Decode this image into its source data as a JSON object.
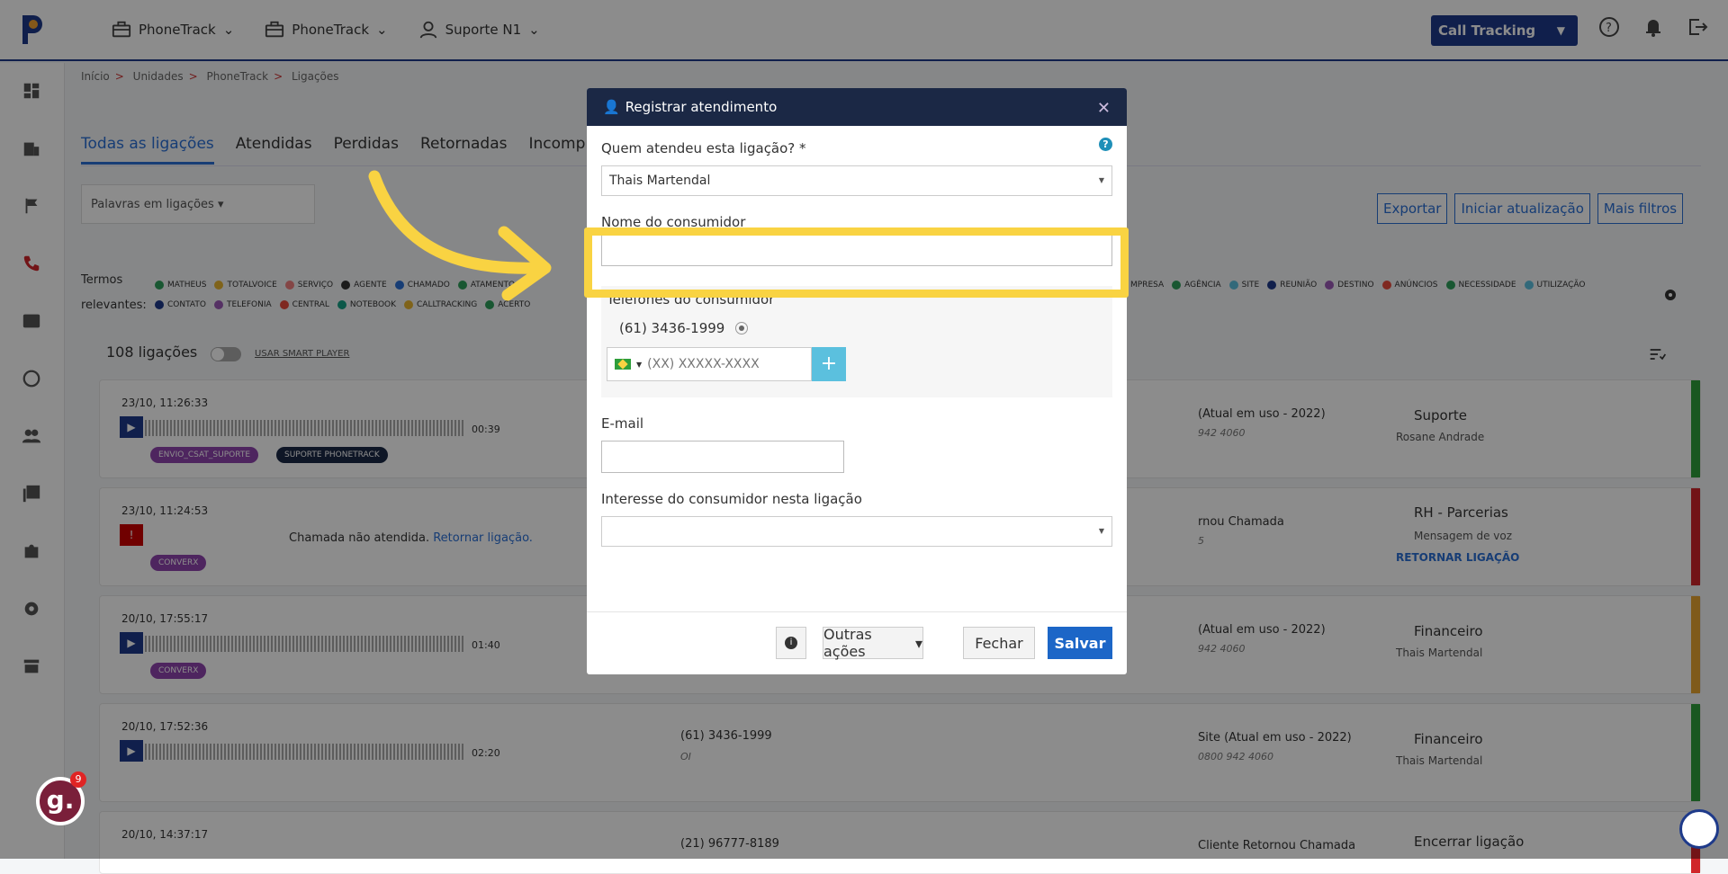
{
  "topbar": {
    "nav": [
      {
        "label": "PhoneTrack",
        "icon": "briefcase-icon"
      },
      {
        "label": "PhoneTrack",
        "icon": "briefcase-icon"
      },
      {
        "label": "Suporte N1",
        "icon": "user-icon"
      }
    ],
    "product_select": "Call Tracking"
  },
  "breadcrumb": [
    "Início",
    "Unidades",
    "PhoneTrack",
    "Ligações"
  ],
  "tabs": [
    "Todas as ligações",
    "Atendidas",
    "Perdidas",
    "Retornadas",
    "Incomple"
  ],
  "filters": {
    "search_placeholder": "Palavras em ligações",
    "buttons": [
      "Exportar",
      "Iniciar atualização",
      "Mais filtros"
    ]
  },
  "terms": {
    "label1": "Termos",
    "label2": "relevantes:",
    "row1": [
      {
        "t": "MATHEUS",
        "c": "#2e9e5b"
      },
      {
        "t": "TOTALVOICE",
        "c": "#e8b530"
      },
      {
        "t": "SERVIÇO",
        "c": "#f08080"
      },
      {
        "t": "AGENTE",
        "c": "#333333"
      },
      {
        "t": "CHAMADO",
        "c": "#2a6fd6"
      },
      {
        "t": "ATAMENTO",
        "c": "#2e9e5b"
      }
    ],
    "row1b": [
      {
        "t": "MPRESA",
        "c": "#e8b530"
      },
      {
        "t": "AGÊNCIA",
        "c": "#2e9e5b"
      },
      {
        "t": "SITE",
        "c": "#5bc0de"
      },
      {
        "t": "REUNIÃO",
        "c": "#1e3a8a"
      },
      {
        "t": "DESTINO",
        "c": "#9b59b6"
      },
      {
        "t": "ANÚNCIOS",
        "c": "#e74c3c"
      },
      {
        "t": "NECESSIDADE",
        "c": "#2e9e5b"
      },
      {
        "t": "UTILIZAÇÃO",
        "c": "#5bc0de"
      }
    ],
    "row2": [
      {
        "t": "CONTATO",
        "c": "#1e3a8a"
      },
      {
        "t": "TELEFONIA",
        "c": "#9b59b6"
      },
      {
        "t": "CENTRAL",
        "c": "#e74c3c"
      },
      {
        "t": "NOTEBOOK",
        "c": "#16a085"
      },
      {
        "t": "CALLTRACKING",
        "c": "#e8b530"
      },
      {
        "t": "ACERTO",
        "c": "#2e9e5b"
      }
    ]
  },
  "list": {
    "count": "108 ligações",
    "smart_player": "USAR SMART PLAYER",
    "cards": [
      {
        "time": "23/10, 11:26:33",
        "duration": "00:39",
        "badges": [
          "ENVIO_CSAT_SUPORTE",
          "SUPORTE PHONETRACK"
        ],
        "mid": "(Atual em uso - 2022)",
        "mid_sub": "942 4060",
        "group": "Suporte",
        "agent": "Rosane Andrade",
        "stripe": "#2e9e3b"
      },
      {
        "time": "23/10, 11:24:53",
        "missed_text": "Chamada não atendida.",
        "missed_link": "Retornar ligação.",
        "badges": [
          "CONVERX"
        ],
        "mid": "rnou Chamada",
        "mid_sub": "5",
        "group": "RH - Parcerias",
        "agent": "Mensagem de voz",
        "action": "RETORNAR LIGAÇÃO",
        "stripe": "#d0262a"
      },
      {
        "time": "20/10, 17:55:17",
        "duration": "01:40",
        "badges": [
          "CONVERX"
        ],
        "mid": "(Atual em uso - 2022)",
        "mid_sub": "942 4060",
        "group": "Financeiro",
        "agent": "Thais Martendal",
        "stripe": "#e8a530"
      },
      {
        "time": "20/10, 17:52:36",
        "duration": "02:20",
        "badges": [],
        "phone": "(61) 3436-1999",
        "phone_sub": "OI",
        "mid": "Site (Atual em uso - 2022)",
        "mid_sub": "0800 942 4060",
        "group": "Financeiro",
        "agent": "Thais Martendal",
        "stripe": "#2e9e3b"
      },
      {
        "time": "20/10, 14:37:17",
        "phone": "(21) 96777-8189",
        "mid": "Cliente Retornou Chamada",
        "group": "Encerrar ligação",
        "stripe": "#d0262a"
      }
    ]
  },
  "modal": {
    "title": "Registrar atendimento",
    "who_label": "Quem atendeu esta ligação? *",
    "who_value": "Thais Martendal",
    "name_label": "Nome do consumidor",
    "name_value": "",
    "phones_label": "Telefones do consumidor",
    "phone_existing": "(61) 3436-1999",
    "phone_placeholder": "(XX) XXXXX-XXXX",
    "email_label": "E-mail",
    "interest_label": "Interesse do consumidor nesta ligação",
    "buttons": {
      "other": "Outras ações",
      "close": "Fechar",
      "save": "Salvar"
    }
  },
  "chat_badge": "9",
  "chat_letter": "g."
}
